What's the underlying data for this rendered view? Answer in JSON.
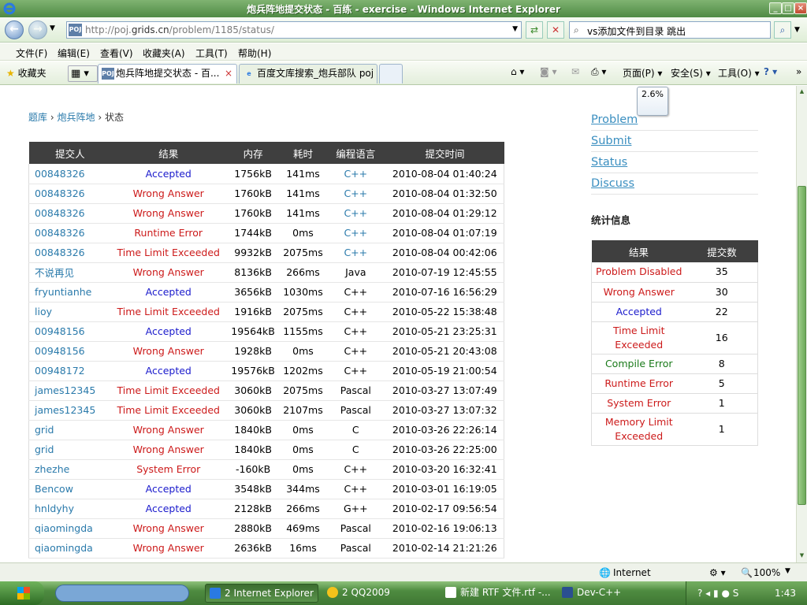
{
  "window": {
    "title": "炮兵阵地提交状态 - 百练 - exercise - Windows Internet Explorer",
    "min": "_",
    "max": "□",
    "close": "×"
  },
  "address": {
    "icon": "POJ",
    "url_prefix": "http://poj.",
    "url_domain": "grids.cn",
    "url_path": "/problem/1185/status/",
    "search": "vs添加文件到目录 跳出"
  },
  "menu": [
    "文件(F)",
    "编辑(E)",
    "查看(V)",
    "收藏夹(A)",
    "工具(T)",
    "帮助(H)"
  ],
  "tabs": {
    "favorites": "收藏夹",
    "active": "炮兵阵地提交状态 - 百...",
    "second": "百度文库搜索_炮兵部队 poj"
  },
  "toolbar": {
    "page": "页面(P)",
    "safety": "安全(S)",
    "tools": "工具(O)"
  },
  "breadcrumb": {
    "root": "题库",
    "problem": "炮兵阵地",
    "current": "状态",
    "sep": "›"
  },
  "table": {
    "headers": [
      "提交人",
      "结果",
      "内存",
      "耗时",
      "编程语言",
      "提交时间"
    ],
    "rows": [
      [
        "00848326",
        "Accepted",
        "1756kB",
        "141ms",
        "C++",
        "2010-08-04 01:40:24"
      ],
      [
        "00848326",
        "Wrong Answer",
        "1760kB",
        "141ms",
        "C++",
        "2010-08-04 01:32:50"
      ],
      [
        "00848326",
        "Wrong Answer",
        "1760kB",
        "141ms",
        "C++",
        "2010-08-04 01:29:12"
      ],
      [
        "00848326",
        "Runtime Error",
        "1744kB",
        "0ms",
        "C++",
        "2010-08-04 01:07:19"
      ],
      [
        "00848326",
        "Time Limit Exceeded",
        "9932kB",
        "2075ms",
        "C++",
        "2010-08-04 00:42:06"
      ],
      [
        "不说再见",
        "Wrong Answer",
        "8136kB",
        "266ms",
        "Java",
        "2010-07-19 12:45:55"
      ],
      [
        "fryuntianhe",
        "Accepted",
        "3656kB",
        "1030ms",
        "C++",
        "2010-07-16 16:56:29"
      ],
      [
        "lioy",
        "Time Limit Exceeded",
        "1916kB",
        "2075ms",
        "C++",
        "2010-05-22 15:38:48"
      ],
      [
        "00948156",
        "Accepted",
        "19564kB",
        "1155ms",
        "C++",
        "2010-05-21 23:25:31"
      ],
      [
        "00948156",
        "Wrong Answer",
        "1928kB",
        "0ms",
        "C++",
        "2010-05-21 20:43:08"
      ],
      [
        "00948172",
        "Accepted",
        "19576kB",
        "1202ms",
        "C++",
        "2010-05-19 21:00:54"
      ],
      [
        "james12345",
        "Time Limit Exceeded",
        "3060kB",
        "2075ms",
        "Pascal",
        "2010-03-27 13:07:49"
      ],
      [
        "james12345",
        "Time Limit Exceeded",
        "3060kB",
        "2107ms",
        "Pascal",
        "2010-03-27 13:07:32"
      ],
      [
        "grid",
        "Wrong Answer",
        "1840kB",
        "0ms",
        "C",
        "2010-03-26 22:26:14"
      ],
      [
        "grid",
        "Wrong Answer",
        "1840kB",
        "0ms",
        "C",
        "2010-03-26 22:25:00"
      ],
      [
        "zhezhe",
        "System Error",
        "-160kB",
        "0ms",
        "C++",
        "2010-03-20 16:32:41"
      ],
      [
        "Bencow",
        "Accepted",
        "3548kB",
        "344ms",
        "C++",
        "2010-03-01 16:19:05"
      ],
      [
        "hnldyhy",
        "Accepted",
        "2128kB",
        "266ms",
        "G++",
        "2010-02-17 09:56:54"
      ],
      [
        "qiaomingda",
        "Wrong Answer",
        "2880kB",
        "469ms",
        "Pascal",
        "2010-02-16 19:06:13"
      ],
      [
        "qiaomingda",
        "Wrong Answer",
        "2636kB",
        "16ms",
        "Pascal",
        "2010-02-14 21:21:26"
      ]
    ],
    "lang_link_rows": [
      0,
      1,
      2,
      3,
      4
    ]
  },
  "right": {
    "links": [
      "Problem",
      "Submit",
      "Status",
      "Discuss"
    ],
    "stats_title": "统计信息",
    "stats_headers": [
      "结果",
      "提交数"
    ],
    "stats": [
      [
        "Problem Disabled",
        "35"
      ],
      [
        "Wrong Answer",
        "30"
      ],
      [
        "Accepted",
        "22"
      ],
      [
        "Time Limit Exceeded",
        "16"
      ],
      [
        "Compile Error",
        "8"
      ],
      [
        "Runtime Error",
        "5"
      ],
      [
        "System Error",
        "1"
      ],
      [
        "Memory Limit Exceeded",
        "1"
      ]
    ]
  },
  "zoom_popup": "2.6%",
  "status": {
    "zone": "Internet",
    "zoom": "100%"
  },
  "taskbar": {
    "items": [
      "2 Internet Explorer",
      "2 QQ2009",
      "新建 RTF 文件.rtf -...",
      "Dev-C++"
    ],
    "clock": "1:43"
  },
  "colors": {
    "accepted": "#1a1acc",
    "error": "#cc1a1a",
    "compile": "#1a7a1a",
    "link": "#2a7aab"
  }
}
